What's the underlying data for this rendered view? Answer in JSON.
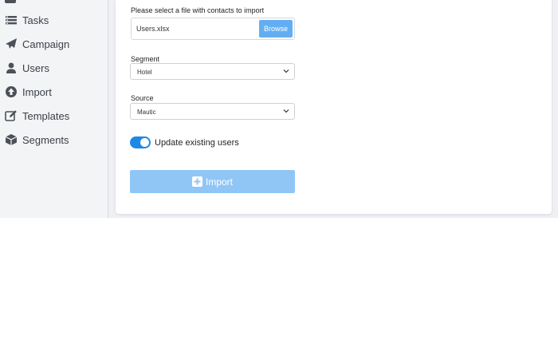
{
  "sidebar": {
    "items": [
      {
        "label": "Tasks",
        "icon": "tasks-icon"
      },
      {
        "label": "Campaign",
        "icon": "paper-plane-icon"
      },
      {
        "label": "Users",
        "icon": "user-icon"
      },
      {
        "label": "Import",
        "icon": "arrow-up-circle-icon"
      },
      {
        "label": "Templates",
        "icon": "edit-icon"
      },
      {
        "label": "Segments",
        "icon": "cube-icon"
      }
    ]
  },
  "form": {
    "file_label": "Please select a file with contacts to import",
    "file_value": "Users.xlsx",
    "browse_label": "Browse",
    "segment_label": "Segment",
    "segment_value": "Hotel",
    "source_label": "Source",
    "source_value": "Mautic",
    "toggle_label": "Update existing users",
    "toggle_on": true,
    "import_label": "Import"
  },
  "colors": {
    "accent": "#1e88e5",
    "browse_button": "#63aef2",
    "import_button": "#90c6f6",
    "sidebar_bg": "#f3f4f6"
  }
}
